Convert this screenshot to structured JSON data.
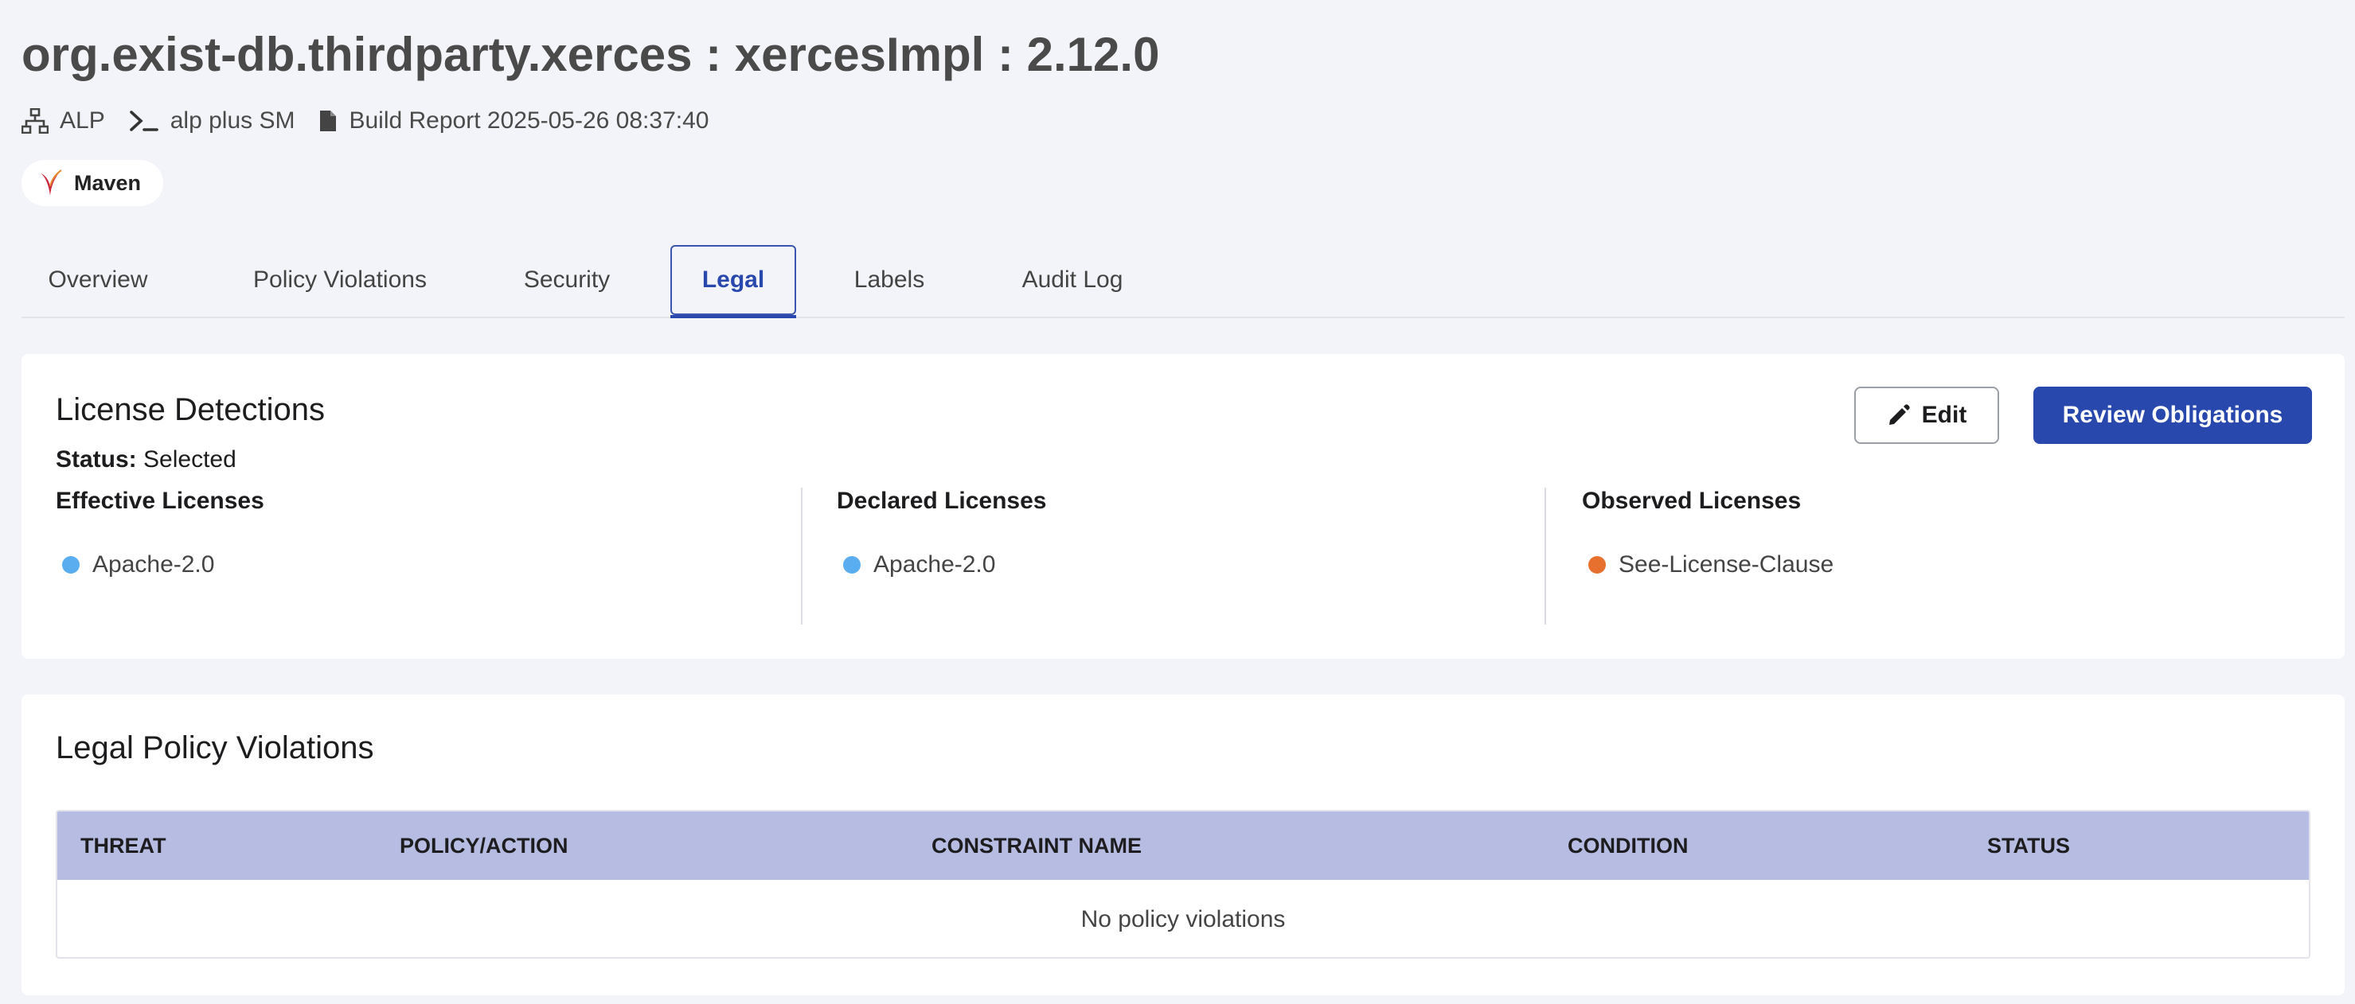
{
  "header": {
    "title": "org.exist-db.thirdparty.xerces : xercesImpl : 2.12.0",
    "meta": {
      "project": "ALP",
      "application": "alp plus SM",
      "build_report": "Build Report 2025-05-26 08:37:40"
    },
    "badge": {
      "label": "Maven",
      "icon": "maven-feather-icon"
    }
  },
  "tabs": [
    {
      "label": "Overview"
    },
    {
      "label": "Policy Violations"
    },
    {
      "label": "Security"
    },
    {
      "label": "Legal",
      "active": true
    },
    {
      "label": "Labels"
    },
    {
      "label": "Audit Log"
    }
  ],
  "license_detections": {
    "title": "License Detections",
    "status_label": "Status:",
    "status_value": "Selected",
    "edit_label": "Edit",
    "review_label": "Review Obligations",
    "columns": [
      {
        "heading": "Effective Licenses",
        "license": "Apache-2.0",
        "dot_color": "#5aaef0"
      },
      {
        "heading": "Declared Licenses",
        "license": "Apache-2.0",
        "dot_color": "#5aaef0"
      },
      {
        "heading": "Observed Licenses",
        "license": "See-License-Clause",
        "dot_color": "#e8702e"
      }
    ]
  },
  "legal_violations": {
    "title": "Legal Policy Violations",
    "columns": [
      "THREAT",
      "POLICY/ACTION",
      "CONSTRAINT NAME",
      "CONDITION",
      "STATUS"
    ],
    "empty_message": "No policy violations"
  },
  "colors": {
    "accent": "#2948ad",
    "table_header": "#b7bde2",
    "background": "#f3f4f9"
  }
}
